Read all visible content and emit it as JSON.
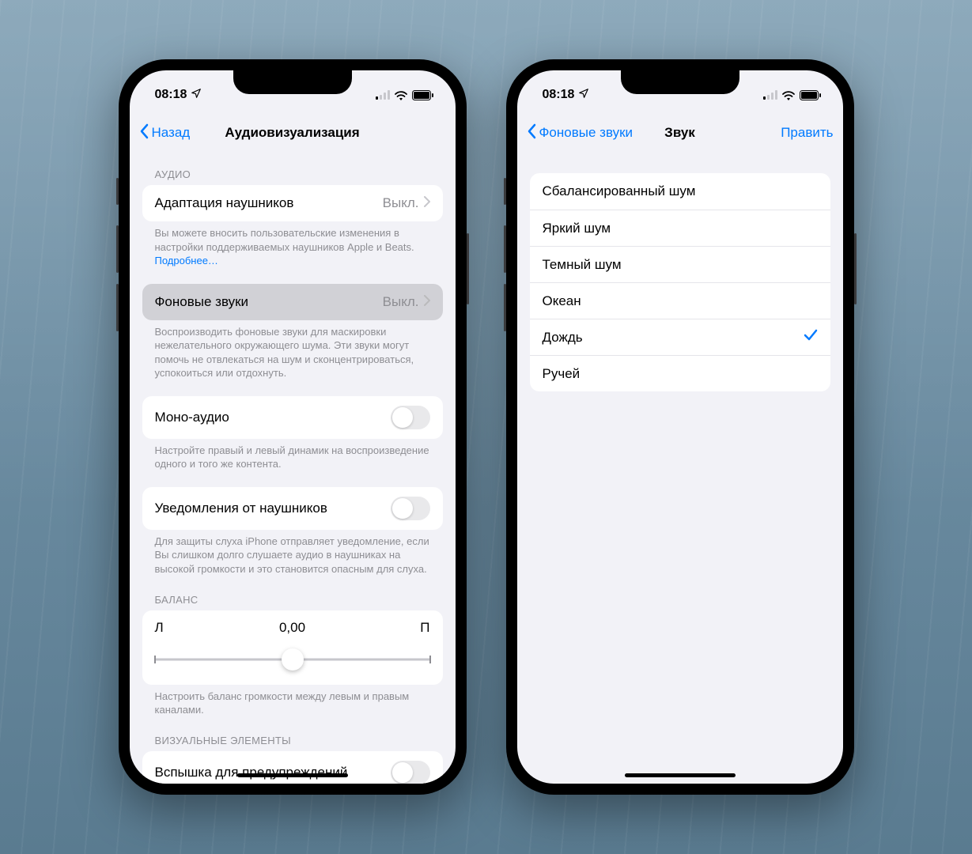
{
  "status": {
    "time": "08:18"
  },
  "left": {
    "nav": {
      "back": "Назад",
      "title": "Аудиовизуализация"
    },
    "sections": {
      "audio": {
        "header": "АУДИО",
        "headphone_adapt": {
          "label": "Адаптация наушников",
          "value": "Выкл."
        },
        "headphone_foot": "Вы можете вносить пользовательские изменения в настройки поддерживаемых наушников Apple и Beats. ",
        "headphone_link": "Подробнее…",
        "bg_sounds": {
          "label": "Фоновые звуки",
          "value": "Выкл."
        },
        "bg_foot": "Воспроизводить фоновые звуки для маскировки нежелательного окружающего шума. Эти звуки могут помочь не отвлекаться на шум и сконцентрироваться, успокоиться или отдохнуть.",
        "mono": {
          "label": "Моно-аудио"
        },
        "mono_foot": "Настройте правый и левый динамик на воспроизведение одного и того же контента.",
        "notif": {
          "label": "Уведомления от наушников"
        },
        "notif_foot": "Для защиты слуха iPhone отправляет уведомление, если Вы слишком долго слушаете аудио в наушниках на высокой громкости и это становится опасным для слуха."
      },
      "balance": {
        "header": "БАЛАНС",
        "l": "Л",
        "r": "П",
        "value": "0,00",
        "foot": "Настроить баланс громкости между левым и правым каналами."
      },
      "visual": {
        "header": "ВИЗУАЛЬНЫЕ ЭЛЕМЕНТЫ",
        "flash": {
          "label": "Вспышка для предупреждений"
        }
      }
    }
  },
  "right": {
    "nav": {
      "back": "Фоновые звуки",
      "title": "Звук",
      "edit": "Править"
    },
    "items": [
      {
        "label": "Сбалансированный шум",
        "selected": false
      },
      {
        "label": "Яркий шум",
        "selected": false
      },
      {
        "label": "Темный шум",
        "selected": false
      },
      {
        "label": "Океан",
        "selected": false
      },
      {
        "label": "Дождь",
        "selected": true
      },
      {
        "label": "Ручей",
        "selected": false
      }
    ]
  }
}
